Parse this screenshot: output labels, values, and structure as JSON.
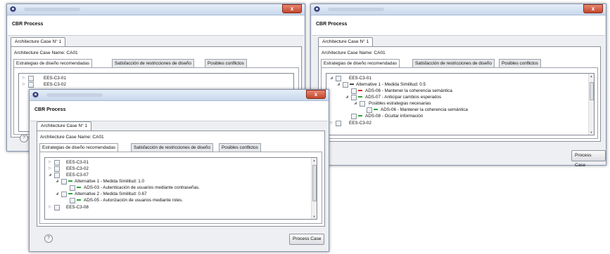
{
  "app_title": "CBR Process",
  "tab_case": "Architecture Case N° 1",
  "case_name": "Architecture Case Name: CA01",
  "tabs": [
    "Estrategias de diseño recomendadas",
    "Satisfacción de restricciones de diseño",
    "Posibles conflictos"
  ],
  "button_label": "Process Case",
  "help_symbol": "?",
  "close_symbol": "x",
  "colors": {
    "red": "#e02020",
    "green": "#2aa33a"
  },
  "window_left": {
    "tree": [
      "EES-C3-01",
      "EES-C3-02"
    ]
  },
  "window_right": {
    "tree": [
      "EES-C3-01",
      "Alternative 1 - Medida Similitud: 0.5",
      "ADS-06 - Mantener la coherencia semántica",
      "ADS-07 - Anticipar cambios esperados",
      "Posibles estrategias necesarias",
      "ADS-06 - Mantener la coherencia semántica",
      "ADS-08 - Ocultar información",
      "EES-C3-02"
    ]
  },
  "window_front": {
    "tree": [
      "EES-C3-01",
      "EES-C3-02",
      "EES-C3-07",
      "Alternative 1 - Medida Similitud: 1.0",
      "ADS-03 - Autenticación de usuarios mediante contraseñas.",
      "Alternative 2 - Medida Similitud: 0.67",
      "ADS-05 - Autorización de usuarios mediante roles.",
      "EES-C3-08"
    ]
  }
}
